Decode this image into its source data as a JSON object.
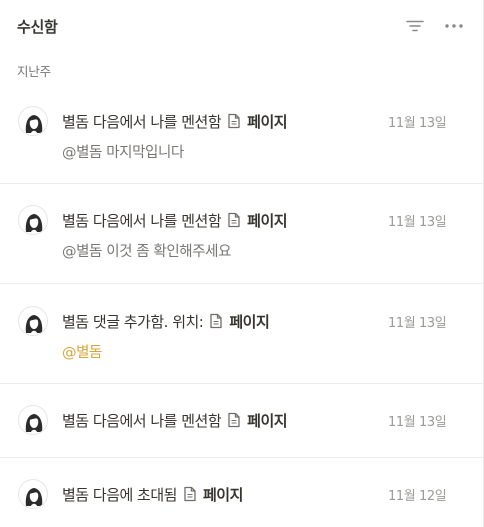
{
  "header": {
    "title": "수신함",
    "filter_icon": "filter-icon",
    "more_icon": "more-horizontal-icon"
  },
  "section_label": "지난주",
  "items": [
    {
      "user": "별돔",
      "action": "다음에서 나를 멘션함",
      "page": "페이지",
      "date": "11월 13일",
      "sub": "@별돔 마지막입니다"
    },
    {
      "user": "별돔",
      "action": "다음에서 나를 멘션함",
      "page": "페이지",
      "date": "11월 13일",
      "sub": "@별돔 이것 좀 확인해주세요"
    },
    {
      "user": "별돔",
      "action": "댓글 추가함. 위치:",
      "page": "페이지",
      "date": "11월 13일",
      "sub": "@별돔"
    },
    {
      "user": "별돔",
      "action": "다음에서 나를 멘션함",
      "page": "페이지",
      "date": "11월 13일",
      "sub": ""
    },
    {
      "user": "별돔",
      "action": "다음에 초대됨",
      "page": "페이지",
      "date": "11월 12일",
      "sub": ""
    }
  ],
  "colors": {
    "text": "#37352f",
    "muted": "#787774",
    "date": "#9b9a97",
    "mention": "#d9a43a",
    "divider": "#ececea"
  }
}
